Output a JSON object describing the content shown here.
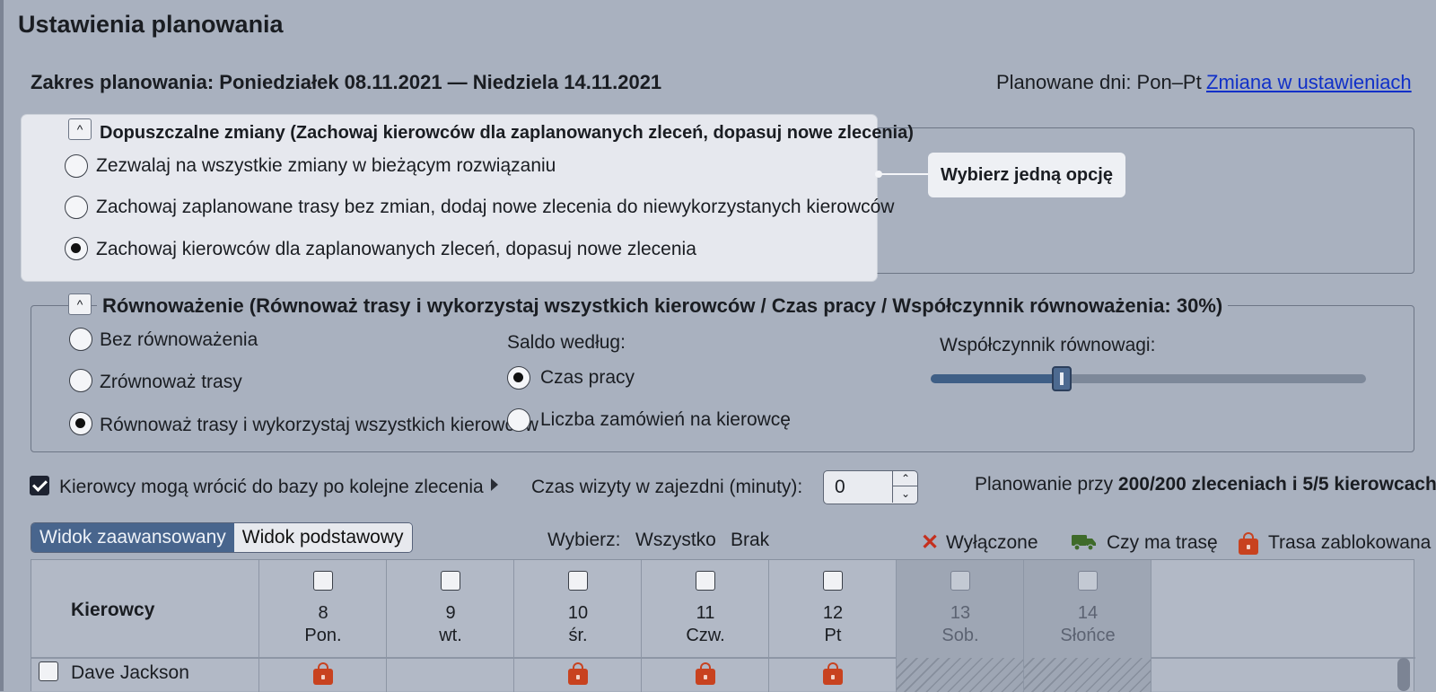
{
  "header": {
    "title": "Ustawienia planowania",
    "range_label": "Zakres planowania:  Poniedziałek 08.11.2021 — Niedziela 14.11.2021",
    "planned_days_label": "Planowane dni:  Pon–Pt",
    "change_link": "Zmiana w ustawieniach"
  },
  "changes_section": {
    "collapse_icon": "^",
    "legend": "Dopuszczalne zmiany (Zachowaj kierowców dla zaplanowanych zleceń, dopasuj nowe zlecenia)",
    "options": [
      {
        "label": "Zezwalaj na wszystkie zmiany w bieżącym rozwiązaniu",
        "selected": false
      },
      {
        "label": "Zachowaj zaplanowane trasy bez zmian, dodaj nowe zlecenia do niewykorzystanych kierowców",
        "selected": false
      },
      {
        "label": "Zachowaj kierowców dla zaplanowanych zleceń, dopasuj nowe zlecenia",
        "selected": true
      }
    ],
    "tooltip": "Wybierz jedną opcję"
  },
  "balancing_section": {
    "collapse_icon": "^",
    "legend": "Równoważenie (Równoważ trasy i wykorzystaj wszystkich kierowców / Czas pracy / Współczynnik równoważenia: 30%)",
    "options": [
      {
        "label": "Bez równoważenia",
        "selected": false
      },
      {
        "label": "Zrównoważ trasy",
        "selected": false
      },
      {
        "label": "Równoważ trasy i wykorzystaj wszystkich kierowców",
        "selected": true
      }
    ],
    "balance_by_label": "Saldo według:",
    "balance_by_options": [
      {
        "label": "Czas pracy",
        "selected": true
      },
      {
        "label": "Liczba zamówień na kierowcę",
        "selected": false
      }
    ],
    "factor_label": "Współczynnik równowagi:",
    "factor_value": 0.3
  },
  "options_row": {
    "return_to_base_label": "Kierowcy mogą wrócić do bazy po kolejne zlecenia",
    "return_to_base_checked": true,
    "visit_time_label": "Czas wizyty w zajezdni (minuty):",
    "visit_time_value": "0",
    "planning_prefix": "Planowanie przy ",
    "planning_bold": "200/200 zleceniach i 5/5 kierowcach"
  },
  "view_tabs": {
    "advanced": "Widok zaawansowany",
    "basic": "Widok podstawowy",
    "active": "advanced"
  },
  "select": {
    "label": "Wybierz:",
    "all": "Wszystko",
    "none": "Brak"
  },
  "legend": {
    "disabled_icon": "✕",
    "disabled_label": "Wyłączone",
    "route_icon": "truck-icon",
    "route_label": "Czy ma trasę",
    "locked_icon": "lock-icon",
    "locked_label": "Trasa zablokowana"
  },
  "grid": {
    "drivers_header": "Kierowcy",
    "days": [
      {
        "num": "8",
        "name": "Pon.",
        "weekend": false
      },
      {
        "num": "9",
        "name": "wt.",
        "weekend": false
      },
      {
        "num": "10",
        "name": "śr.",
        "weekend": false
      },
      {
        "num": "11",
        "name": "Czw.",
        "weekend": false
      },
      {
        "num": "12",
        "name": "Pt",
        "weekend": false
      },
      {
        "num": "13",
        "name": "Sob.",
        "weekend": true
      },
      {
        "num": "14",
        "name": "Słońce",
        "weekend": true
      }
    ],
    "rows": [
      {
        "driver": "Dave Jackson",
        "locked_days": [
          true,
          false,
          true,
          true,
          true,
          false,
          false
        ]
      }
    ]
  },
  "colors": {
    "accent": "#48658d",
    "link": "#1030c8",
    "lock": "#c8421f",
    "disabled_x": "#c5301e",
    "truck": "#3f6b2a"
  }
}
